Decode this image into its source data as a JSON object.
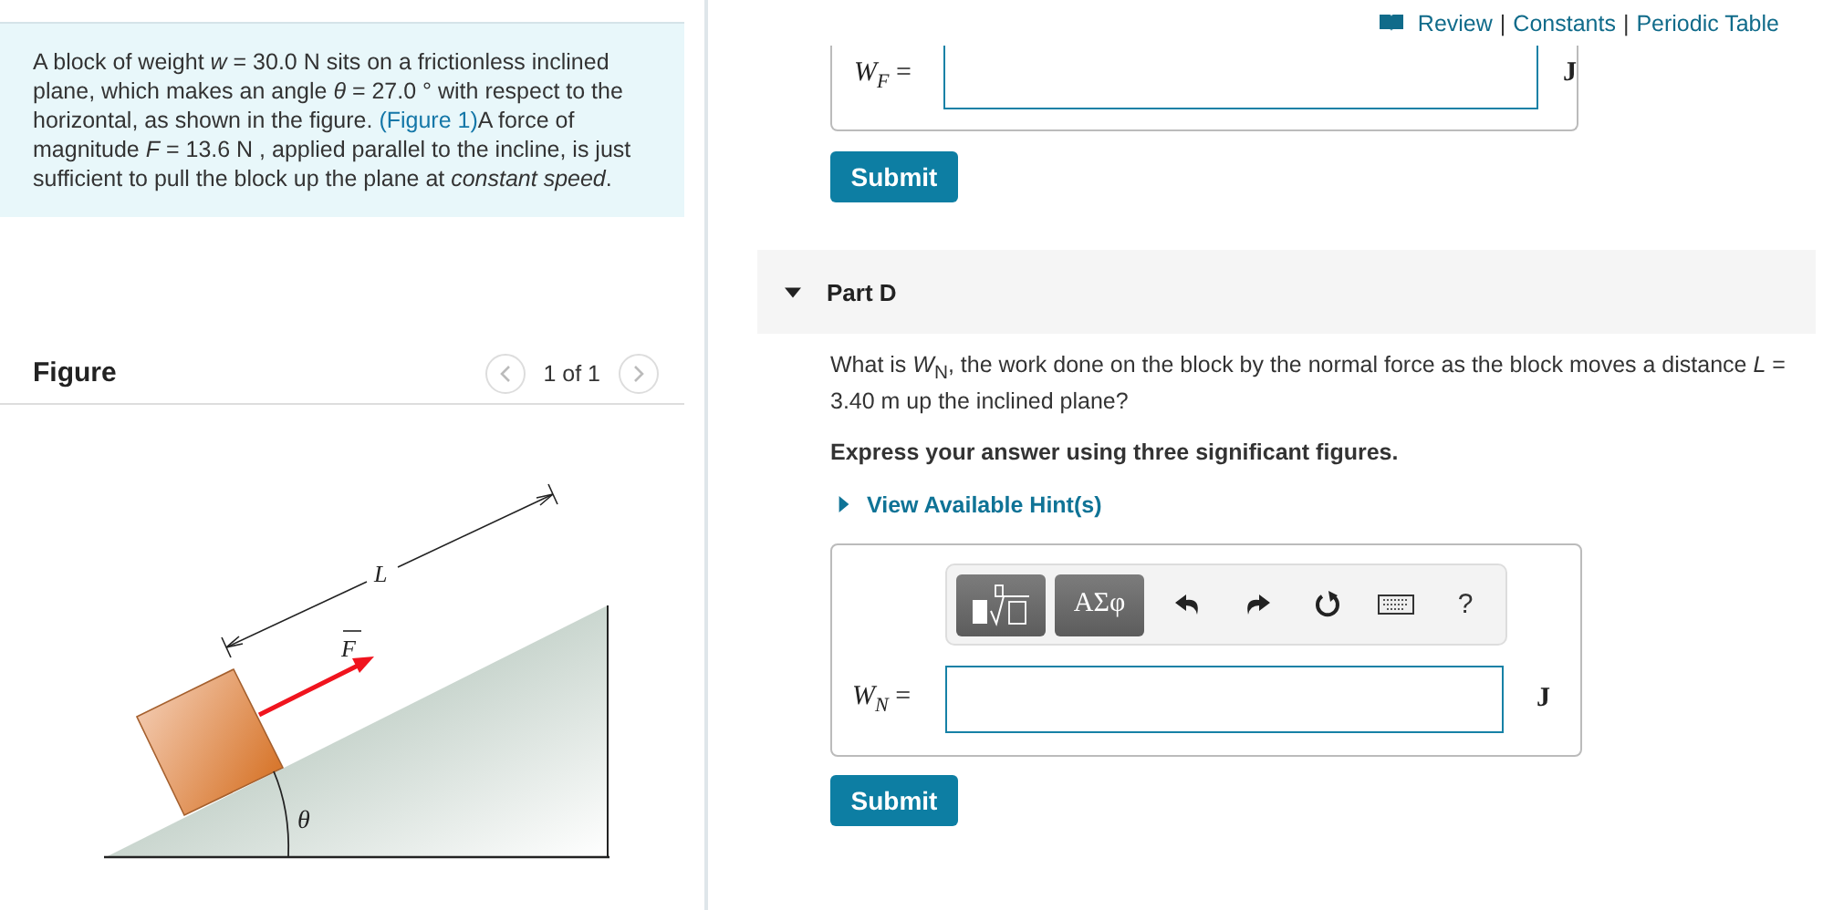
{
  "top_links": {
    "items": [
      "Review",
      "Constants",
      "Periodic Table"
    ],
    "separators": [
      "|",
      "|"
    ]
  },
  "problem": {
    "text_before": "A block of weight *w* = 30.0 N sits on a frictionless inclined plane, which makes an angle *θ* = 27.0 ° with respect to the horizontal, as shown in the figure. ",
    "figure_link": "(Figure 1)",
    "text_after": "A force of magnitude *F* = 13.6 N , applied parallel to the incline, is just sufficient to pull the block up the plane at *constant speed*."
  },
  "figure_panel": {
    "title": "Figure",
    "pager": "1 of 1",
    "labels": {
      "length": "L",
      "force": "F",
      "angle": "θ"
    }
  },
  "previous_answer": {
    "label": "*W*$_{F}$ =",
    "unit": "J",
    "submit": "Submit"
  },
  "part": {
    "title": "Part D",
    "expanded": true,
    "question": "What is *W*$_{N}$, the work done on the block by the normal force as the block moves a distance *L* = 3.40 m up the inclined plane?",
    "instruction": "Express your answer using three significant figures.",
    "hint": {
      "label": "View Available Hint(s)",
      "expanded": false
    },
    "toolbar": {
      "greek": "ΑΣφ",
      "help": "?"
    },
    "answer": {
      "label": "*W*$_{N}$ =",
      "unit": "J"
    },
    "submit": "Submit"
  }
}
